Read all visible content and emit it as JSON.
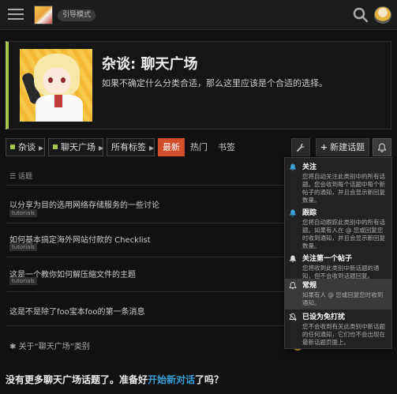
{
  "header": {
    "mode_badge": "引导模式"
  },
  "category": {
    "title": "杂谈: 聊天广场",
    "description": "如果不确定什么分类合适，那么这里应该是个合适的选择。",
    "accent_color": "#a6c84a"
  },
  "toolbar": {
    "crumbs": [
      "杂谈",
      "聊天广场",
      "所有标签"
    ],
    "tabs": [
      "最新",
      "热门",
      "书签"
    ],
    "new_topic_label": "新建话题",
    "active_tab_color": "#d04f2a"
  },
  "list": {
    "header": "话题",
    "topics": [
      {
        "title": "以分享为目的选用网络存储服务的一些讨论",
        "tag": "tutorials"
      },
      {
        "title": "如何基本搞定海外网站付款的 Checklist",
        "tag": "tutorials"
      },
      {
        "title": "这是一个教你如何解压缩文件的主题",
        "tag": "tutorials"
      },
      {
        "title": "这是不是除了foo宝本foo的第一条消息",
        "tag": ""
      }
    ],
    "about": "关于“聊天广场”类别"
  },
  "footer": {
    "text_before": "没有更多聊天广场话题了。准备好",
    "link": "开始新对话",
    "text_after": "了吗？",
    "link_color": "#3aa0d8"
  },
  "notification_menu": {
    "items": [
      {
        "icon": "bell-watching-icon",
        "label": "关注",
        "desc": "您将自动关注此类别中的所有话题。您会收到每个话题中每个新帖子的通知，并且会显示新回复数量。"
      },
      {
        "icon": "bell-tracking-icon",
        "label": "跟踪",
        "desc": "您将自动跟踪此类别中的所有话题。如果有人在 @ 您或回复您时收到通知，并且会显示新回复数量。"
      },
      {
        "icon": "bell-first-post-icon",
        "label": "关注第一个帖子",
        "desc": "您将收到此类别中新话题的通知，但不会收到话题回复。"
      },
      {
        "icon": "bell-regular-icon",
        "label": "常规",
        "desc": "如果有人 @ 您或回复您时收到通知。"
      },
      {
        "icon": "bell-muted-icon",
        "label": "已设为免打扰",
        "desc": "您不会收到有关此类别中新话题的任何通知，它们也不会出现在最新话题页面上。"
      }
    ],
    "selected_index": 3
  }
}
